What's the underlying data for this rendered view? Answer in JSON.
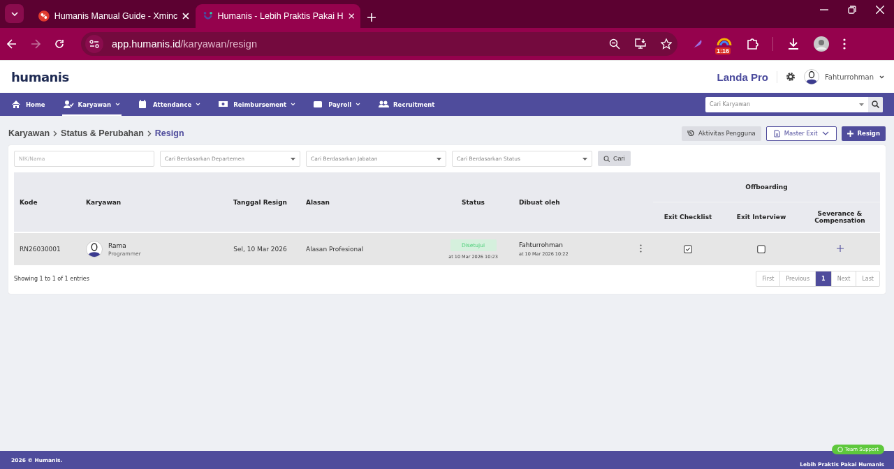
{
  "browser": {
    "tabs": [
      {
        "title": "Humanis Manual Guide - Xminc",
        "selected": false
      },
      {
        "title": "Humanis - Lebih Praktis Pakai H",
        "selected": true
      }
    ],
    "url_host": "app.humanis.id",
    "url_path": "/karyawan/resign",
    "extension_badge": "1:16"
  },
  "header": {
    "logo": "humanis",
    "company": "Landa Pro",
    "user": "Fahturrohman"
  },
  "nav": {
    "items": [
      {
        "label": "Home",
        "dropdown": false,
        "selected": false
      },
      {
        "label": "Karyawan",
        "dropdown": true,
        "selected": true
      },
      {
        "label": "Attendance",
        "dropdown": true,
        "selected": false
      },
      {
        "label": "Reimbursement",
        "dropdown": true,
        "selected": false
      },
      {
        "label": "Payroll",
        "dropdown": true,
        "selected": false
      },
      {
        "label": "Recruitment",
        "dropdown": false,
        "selected": false
      }
    ],
    "search_placeholder": "Cari Karyawan"
  },
  "breadcrumb": [
    "Karyawan",
    "Status & Perubahan",
    "Resign"
  ],
  "actions": [
    {
      "label": "Aktivitas Pengguna",
      "kind": "history"
    },
    {
      "label": "Master Exit",
      "kind": "dropdown"
    },
    {
      "label": "Resign",
      "kind": "primary"
    }
  ],
  "filters": [
    {
      "placeholder": "NIK/Nama",
      "kind": "text"
    },
    {
      "placeholder": "Cari Berdasarkan Departemen",
      "kind": "select"
    },
    {
      "placeholder": "Cari Berdasarkan Jabatan",
      "kind": "select"
    },
    {
      "placeholder": "Cari Berdasarkan Status",
      "kind": "select"
    }
  ],
  "search_button": "Cari",
  "table": {
    "columns": [
      "Kode",
      "Karyawan",
      "Tanggal Resign",
      "Alasan",
      "Status",
      "Dibuat oleh"
    ],
    "group": "Offboarding",
    "sub_columns": [
      "Exit Checklist",
      "Exit Interview",
      "Severance & Compensation"
    ],
    "rows": [
      {
        "kode": "RN26030001",
        "name": "Rama",
        "position": "Programmer",
        "date": "Sel, 10 Mar 2026",
        "reason": "Alasan Profesional",
        "status": "Disetujui",
        "status_time": "at 10 Mar 2026 10:23",
        "created_by": "Fahturrohman",
        "created_at": "at 10 Mar 2026 10:22",
        "exit_checklist": true,
        "exit_interview": false
      }
    ]
  },
  "pagination": {
    "info": "Showing 1 to 1 of 1 entries",
    "buttons": [
      {
        "label": "First",
        "selected": false,
        "disabled": true
      },
      {
        "label": "Previous",
        "selected": false,
        "disabled": true
      },
      {
        "label": "1",
        "selected": true,
        "disabled": false
      },
      {
        "label": "Next",
        "selected": false,
        "disabled": true
      },
      {
        "label": "Last",
        "selected": false,
        "disabled": true
      }
    ]
  },
  "footer": {
    "copyright": "2026 © Humanis.",
    "tagline": "Lebih Praktis Pakai Humanis",
    "support": "Team Support"
  }
}
